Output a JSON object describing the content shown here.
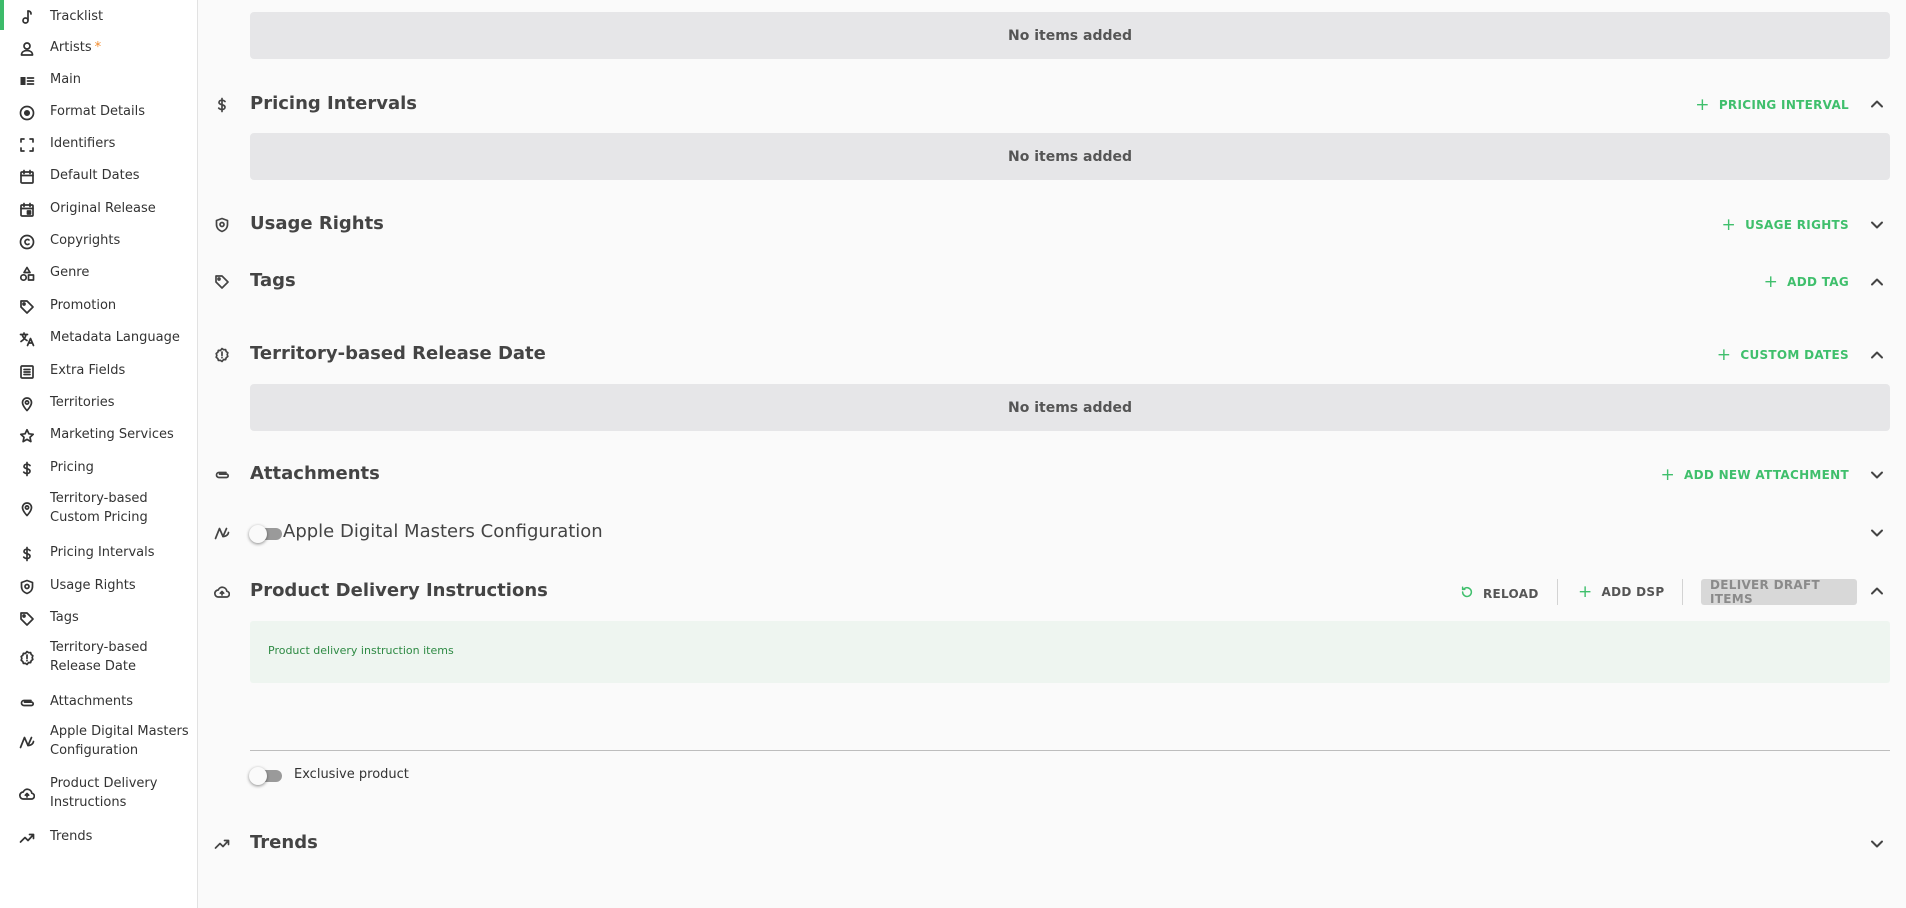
{
  "sidebar": {
    "items": [
      {
        "label": "Tracklist",
        "icon": "music-note-icon"
      },
      {
        "label": "Artists",
        "icon": "person-icon",
        "required_mark": "*"
      },
      {
        "label": "Main",
        "icon": "id-card-icon"
      },
      {
        "label": "Format Details",
        "icon": "disc-icon"
      },
      {
        "label": "Identifiers",
        "icon": "scan-frame-icon"
      },
      {
        "label": "Default Dates",
        "icon": "calendar-icon"
      },
      {
        "label": "Original Release",
        "icon": "calendar-event-icon"
      },
      {
        "label": "Copyrights",
        "icon": "copyright-icon"
      },
      {
        "label": "Genre",
        "icon": "shapes-icon"
      },
      {
        "label": "Promotion",
        "icon": "tag-icon"
      },
      {
        "label": "Metadata Language",
        "icon": "translate-icon"
      },
      {
        "label": "Extra Fields",
        "icon": "list-box-icon"
      },
      {
        "label": "Territories",
        "icon": "map-pin-icon"
      },
      {
        "label": "Marketing Services",
        "icon": "star-icon"
      },
      {
        "label": "Pricing",
        "icon": "dollar-icon"
      },
      {
        "label": "Territory-based Custom Pricing",
        "icon": "map-pin-icon"
      },
      {
        "label": "Pricing Intervals",
        "icon": "dollar-icon"
      },
      {
        "label": "Usage Rights",
        "icon": "shield-icon"
      },
      {
        "label": "Tags",
        "icon": "tag-icon"
      },
      {
        "label": "Territory-based Release Date",
        "icon": "alert-badge-icon"
      },
      {
        "label": "Attachments",
        "icon": "paperclip-icon"
      },
      {
        "label": "Apple Digital Masters Configuration",
        "icon": "apple-masters-icon"
      },
      {
        "label": "Product Delivery Instructions",
        "icon": "cloud-upload-icon"
      },
      {
        "label": "Trends",
        "icon": "trending-up-icon"
      }
    ],
    "active_color": "#3dbb6a"
  },
  "main": {
    "empty_text": "No items added",
    "sections": {
      "pricing_intervals": {
        "title": "Pricing Intervals",
        "action": "PRICING INTERVAL"
      },
      "usage_rights": {
        "title": "Usage Rights",
        "action": "USAGE RIGHTS"
      },
      "tags": {
        "title": "Tags",
        "action": "ADD TAG"
      },
      "territory_release": {
        "title": "Territory-based Release Date",
        "action": "CUSTOM DATES"
      },
      "attachments": {
        "title": "Attachments",
        "action": "ADD NEW ATTACHMENT"
      },
      "apple_masters": {
        "title": "Apple Digital Masters Configuration"
      },
      "delivery": {
        "title": "Product Delivery Instructions",
        "reload": "RELOAD",
        "add_dsp": "ADD DSP",
        "deliver": "DELIVER DRAFT ITEMS",
        "panel_text": "Product delivery instruction items"
      },
      "exclusive": {
        "label": "Exclusive product"
      },
      "trends": {
        "title": "Trends"
      }
    },
    "accent_color": "#3fbf6c"
  }
}
